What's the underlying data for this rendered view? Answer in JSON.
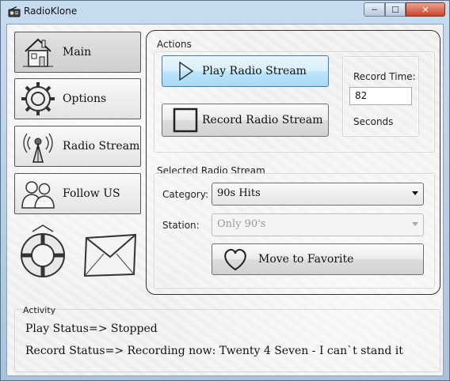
{
  "window": {
    "title": "RadioKlone",
    "controls": {
      "minimize": "─",
      "maximize": "☐",
      "close": "✕"
    }
  },
  "nav": {
    "items": [
      {
        "label": "Main",
        "icon": "house-icon",
        "active": true
      },
      {
        "label": "Options",
        "icon": "gear-icon",
        "active": false
      },
      {
        "label": "Radio Stream",
        "icon": "antenna-icon",
        "active": false
      },
      {
        "label": "Follow US",
        "icon": "people-icon",
        "active": false
      }
    ],
    "decorations": [
      "lifebuoy-icon",
      "envelope-icon"
    ]
  },
  "actions": {
    "title": "Actions",
    "play_label": "Play Radio Stream",
    "record_label": "Record Radio Stream",
    "record_time_label": "Record Time:",
    "record_time_value": "82",
    "seconds_label": "Seconds"
  },
  "selected_stream": {
    "title": "Selected Radio Stream",
    "category_label": "Category:",
    "category_value": "90s Hits",
    "station_label": "Station:",
    "station_value": "Only 90's",
    "favorite_label": "Move to Favorite"
  },
  "activity": {
    "title": "Activity",
    "play_status": "Play Status=> Stopped",
    "record_status": "Record Status=> Recording now: Twenty 4 Seven - I can`t stand it"
  }
}
